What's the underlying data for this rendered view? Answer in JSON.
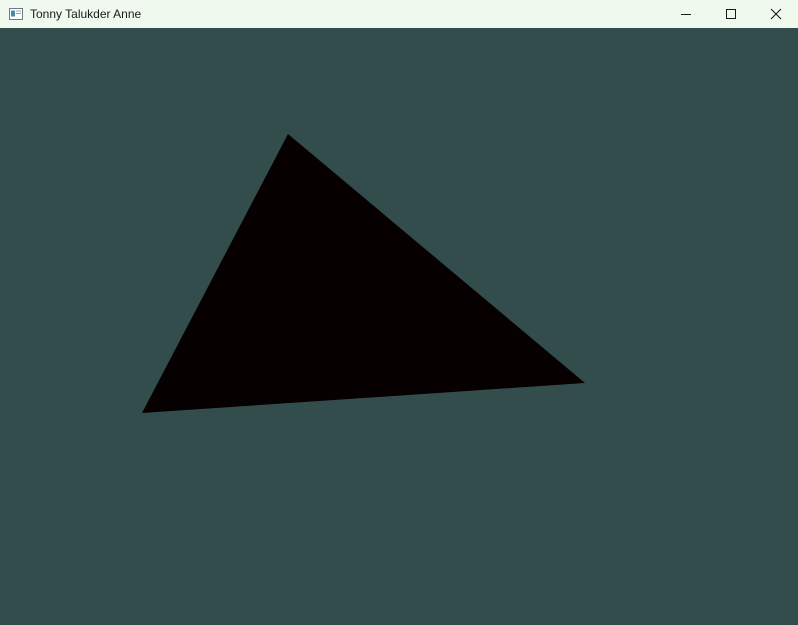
{
  "window": {
    "title": "Tonny Talukder Anne",
    "background_color": "#334d4d",
    "titlebar_color": "#eff9ee",
    "icons": {
      "app": "app-window-icon",
      "minimize": "minimize-icon",
      "maximize": "maximize-icon",
      "close": "close-icon"
    }
  },
  "scene": {
    "shape": "triangle",
    "fill_color": "#070000"
  }
}
